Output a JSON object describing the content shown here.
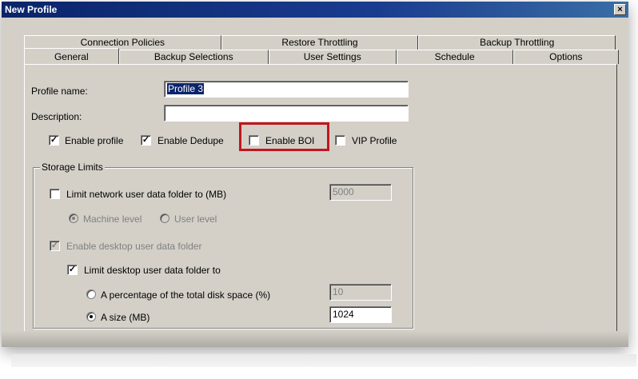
{
  "window": {
    "title": "New Profile",
    "close_label": "×"
  },
  "tabs_back": [
    "Connection Policies",
    "Restore Throttling",
    "Backup Throttling"
  ],
  "tabs_front": [
    "General",
    "Backup Selections",
    "User Settings",
    "Schedule",
    "Options"
  ],
  "active_tab": "General",
  "form": {
    "profile_name_label": "Profile name:",
    "profile_name_value": "Profile 3",
    "description_label": "Description:",
    "description_value": ""
  },
  "options": {
    "enable_profile": {
      "label": "Enable profile",
      "checked": true
    },
    "enable_dedupe": {
      "label": "Enable Dedupe",
      "checked": true
    },
    "enable_boi": {
      "label": "Enable BOI",
      "checked": false
    },
    "vip_profile": {
      "label": "VIP Profile",
      "checked": false
    }
  },
  "storage": {
    "legend": "Storage Limits",
    "limit_network_label": "Limit network user data folder to (MB)",
    "limit_network_value": "5000",
    "machine_level_label": "Machine level",
    "user_level_label": "User level",
    "enable_desktop_label": "Enable desktop user data folder",
    "limit_desktop_label": "Limit desktop user data folder to",
    "percentage_label": "A percentage of the total disk space (%)",
    "percentage_value": "10",
    "size_label": "A size (MB)",
    "size_value": "1024"
  },
  "colors": {
    "highlight": "#c0161e",
    "titlebar": "#0a246a",
    "face": "#d4d0c8"
  }
}
